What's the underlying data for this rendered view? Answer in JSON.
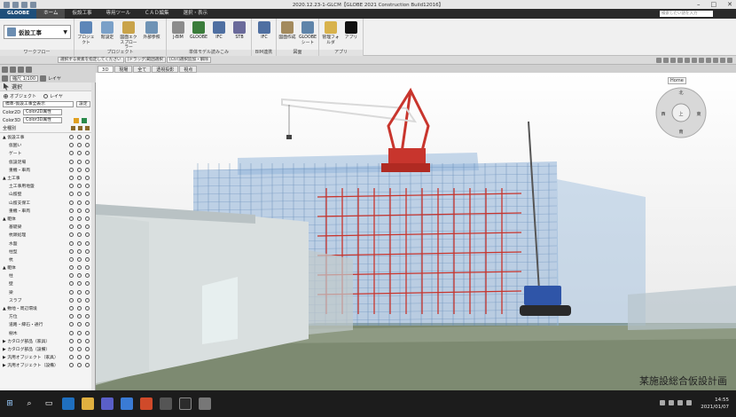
{
  "window": {
    "title": "2020.12.23-1-GLCM【GLOBE 2021 Construction Build12016】"
  },
  "menu": {
    "tabs": [
      "GLOOBE",
      "ホーム",
      "仮設工事",
      "専用ツール",
      "ＣＡＤ編集",
      "選択・表示"
    ],
    "search_placeholder": "検索したい語を入力"
  },
  "ribbon": {
    "project_selector": "仮設工事",
    "groups": [
      {
        "label": "ワークフロー"
      },
      {
        "label": "プロジェクト",
        "buttons": [
          "プロジェクト",
          "階設定",
          "図面エクスプローラー",
          "外部参照"
        ]
      },
      {
        "label": "単体モデル読みこみ",
        "buttons": [
          "J-BIM",
          "GLOOBE",
          "IFC",
          "STB"
        ]
      },
      {
        "label": "BIM連携",
        "buttons": [
          "IFC"
        ]
      },
      {
        "label": "図面",
        "buttons": [
          "図面作成",
          "GLOOBEシート"
        ]
      },
      {
        "label": "アプリ",
        "buttons": [
          "管理フォルダ",
          "アプリ"
        ]
      }
    ]
  },
  "toolbar": {
    "info_items": [
      "選択する要素を指定してください",
      "[ドラッグ]範囲選択",
      "[Ctrl]選択追加・解除"
    ],
    "scale": "縮尺 1/100",
    "layer_label": "レイヤ"
  },
  "panel": {
    "title": "選択",
    "radio": [
      {
        "label": "オブジェクト",
        "checked": true
      },
      {
        "label": "レイヤ",
        "checked": false
      }
    ],
    "filter": "標準-仮設工事全表示",
    "filter_btn": "設定",
    "color2d_label": "Color2D",
    "color2d_value": "Color2D属性",
    "color3d_label": "Color3D",
    "color3d_value": "Color3D属性",
    "tree_header": "全種別",
    "tree": [
      "▲ 仮設工事",
      "仮囲い",
      "ゲート",
      "仮設足場",
      "重機・車両",
      "▲ 土工事",
      "土工事用地盤",
      "山留壁",
      "山留支保工",
      "重機・車両",
      "▲ 躯体",
      "基礎梁",
      "杭頭処理",
      "水盤",
      "柱型",
      "杭",
      "▲ 躯体",
      "柱",
      "壁",
      "梁",
      "スラブ",
      "▲ 敷地・周辺環境",
      "方位",
      "道路・縁石・通行",
      "樹木",
      "▶ カタログ部品（家具）",
      "▶ カタログ部品（設備）",
      "▶ 汎用オブジェクト（家具）",
      "▶ 汎用オブジェクト（設備）"
    ]
  },
  "view": {
    "tabs": [
      "3Ｄ",
      "現場",
      "全て",
      "透視投影",
      "視点"
    ],
    "home_label": "Home",
    "compass": [
      "北",
      "東",
      "南",
      "西",
      "上"
    ],
    "caption": "某施設総合仮設計画"
  },
  "taskbar": {
    "time": "14:55",
    "date": "2021/01/07"
  },
  "colors": {
    "steel": "#c8352d",
    "scaffold": "#8fb3d9",
    "ground": "#7d8a71",
    "crane_body": "#2f55a8"
  }
}
